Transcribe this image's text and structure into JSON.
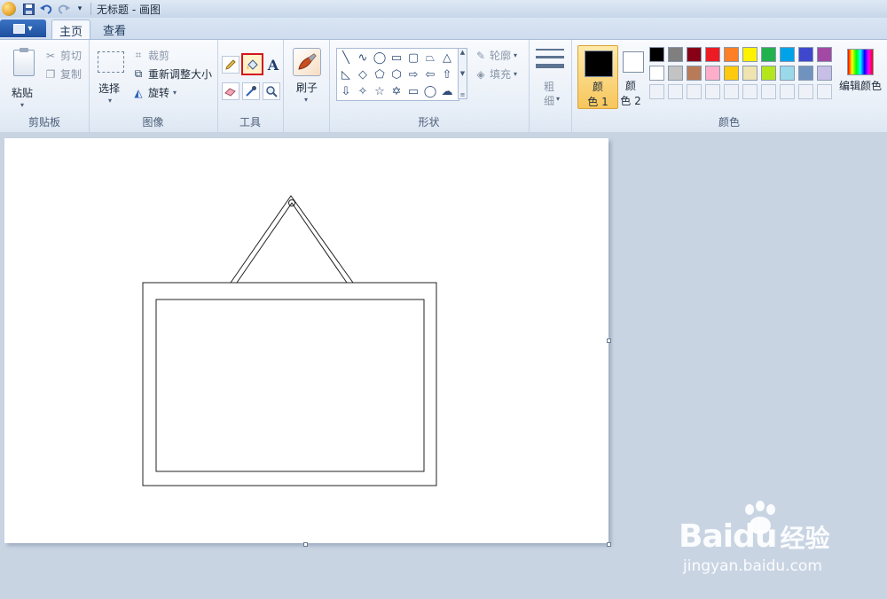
{
  "window": {
    "title": "无标题 - 画图"
  },
  "tabs": [
    {
      "label": "主页",
      "active": true
    },
    {
      "label": "查看",
      "active": false
    }
  ],
  "ribbon": {
    "clipboard": {
      "paste_label": "粘贴",
      "cut_label": "剪切",
      "copy_label": "复制",
      "group_label": "剪贴板"
    },
    "image": {
      "select_label": "选择",
      "crop_label": "裁剪",
      "resize_label": "重新调整大小",
      "rotate_label": "旋转",
      "group_label": "图像"
    },
    "tools": {
      "group_label": "工具",
      "items": [
        "pencil-icon",
        "fill-bucket-icon",
        "text-icon",
        "eraser-icon",
        "color-picker-icon",
        "magnifier-icon"
      ],
      "selected": "fill-bucket-icon"
    },
    "brushes": {
      "label": "刷子"
    },
    "shapes": {
      "group_label": "形状",
      "outline_label": "轮廓",
      "fill_label": "填充"
    },
    "size": {
      "label_line1": "粗",
      "label_line2": "细"
    },
    "colors": {
      "group_label": "颜色",
      "color1_label_line1": "颜",
      "color1_label_line2": "色 1",
      "color2_label_line1": "颜",
      "color2_label_line2": "色 2",
      "color1_value": "#000000",
      "color2_value": "#ffffff",
      "edit_label": "编辑颜色",
      "palette_row1": [
        "#000000",
        "#7f7f7f",
        "#880015",
        "#ed1c24",
        "#ff7f27",
        "#fff200",
        "#22b14c",
        "#00a2e8",
        "#3f48cc",
        "#a349a4"
      ],
      "palette_row2": [
        "#ffffff",
        "#c3c3c3",
        "#b97a57",
        "#ffaec9",
        "#ffc90e",
        "#efe4b0",
        "#b5e61d",
        "#99d9ea",
        "#7092be",
        "#c8bfe7"
      ],
      "palette_row3": [
        "",
        "",
        "",
        "",
        "",
        "",
        "",
        "",
        "",
        ""
      ]
    }
  },
  "watermark": {
    "brand": "Bai",
    "brand_tail": "du",
    "brand_cn": "经验",
    "url": "jingyan.baidu.com"
  }
}
